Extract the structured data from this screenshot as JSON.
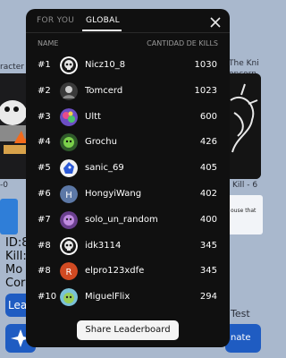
{
  "background": {
    "left_title": "racter",
    "right_title": [
      "The Kni",
      "opcorn"
    ],
    "left_kill": "-0",
    "right_kill": "Kill - 6",
    "right_box_text": "ouse that",
    "left_stats": [
      "ID:8",
      "Kill:",
      "Mo",
      "Cor"
    ],
    "left_button_label": "Lea",
    "right_test": "Test",
    "right_button_label": "nate"
  },
  "modal": {
    "tabs": {
      "for_you": "FOR YOU",
      "global": "GLOBAL"
    },
    "close_icon": "close-icon",
    "headers": {
      "name": "NAME",
      "kills": "CANTIDAD DE KILLS"
    },
    "rows": [
      {
        "rank": "#1",
        "name": "Nicz10_8",
        "kills": "1030",
        "avatar_icon": "avatar-skull-icon"
      },
      {
        "rank": "#2",
        "name": "Tomcerd",
        "kills": "1023",
        "avatar_icon": "avatar-photo-icon"
      },
      {
        "rank": "#3",
        "name": "Ultt",
        "kills": "600",
        "avatar_icon": "avatar-colorful-icon"
      },
      {
        "rank": "#4",
        "name": "Grochu",
        "kills": "426",
        "avatar_icon": "avatar-green-icon"
      },
      {
        "rank": "#5",
        "name": "sanic_69",
        "kills": "405",
        "avatar_icon": "avatar-sonic-icon"
      },
      {
        "rank": "#6",
        "name": "HongyiWang",
        "kills": "402",
        "avatar_icon": "avatar-letter-icon",
        "avatar_letter": "H",
        "avatar_color": "#5c78a6"
      },
      {
        "rank": "#7",
        "name": "solo_un_random",
        "kills": "400",
        "avatar_icon": "avatar-purple-icon"
      },
      {
        "rank": "#8",
        "name": "idk3114",
        "kills": "345",
        "avatar_icon": "avatar-skull-icon"
      },
      {
        "rank": "#8",
        "name": "elpro123xdfe",
        "kills": "345",
        "avatar_icon": "avatar-letter-icon",
        "avatar_letter": "R",
        "avatar_color": "#d14a22"
      },
      {
        "rank": "#10",
        "name": "MiguelFlix",
        "kills": "294",
        "avatar_icon": "avatar-cartoon-icon"
      }
    ],
    "share_label": "Share Leaderboard"
  }
}
